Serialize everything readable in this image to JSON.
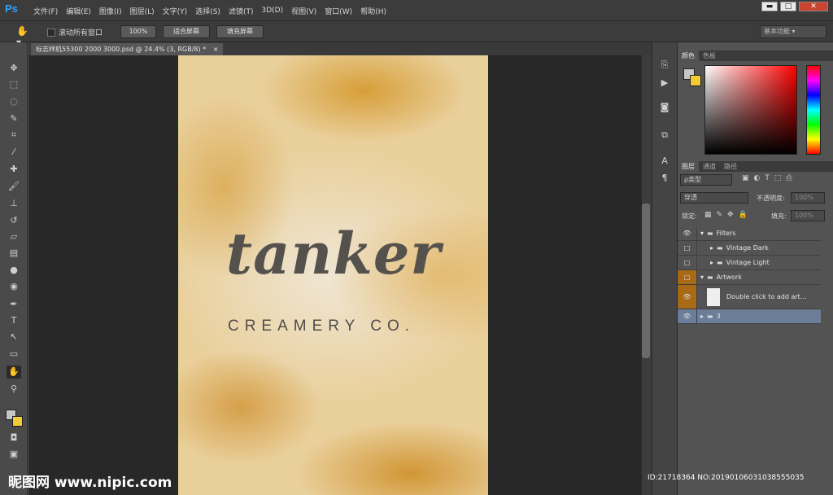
{
  "app": {
    "logo": "Ps"
  },
  "menu": [
    "文件(F)",
    "编辑(E)",
    "图像(I)",
    "图层(L)",
    "文字(Y)",
    "选择(S)",
    "滤镜(T)",
    "3D(D)",
    "视图(V)",
    "窗口(W)",
    "帮助(H)"
  ],
  "window_controls": {
    "minimize": "▬",
    "maximize": "□",
    "close": "✕"
  },
  "options": {
    "hand_icon": "hand-icon",
    "scroll_all_label": "滚动所有窗口",
    "btn_100": "100%",
    "btn_fit": "适合屏幕",
    "btn_fill": "填充屏幕",
    "workspace": "基本功能"
  },
  "document": {
    "tab_title": "标志样机55300 2000 3000.psd @ 24.4% (3, RGB/8) *",
    "tab_close": "×",
    "brand_name": "tanker",
    "brand_sub": "CREAMERY CO."
  },
  "color_panel": {
    "tabs": [
      "颜色",
      "色板"
    ],
    "foreground": "#c6c6c6",
    "background": "#f4ca3a"
  },
  "layers_panel": {
    "tabs": [
      "图层",
      "通道",
      "路径"
    ],
    "filter_label": "ρ类型",
    "blend_mode": "穿透",
    "opacity_label": "不透明度:",
    "opacity_value": "100%",
    "lock_label": "锁定:",
    "fill_label": "填充:",
    "fill_value": "100%",
    "layers": [
      {
        "name": "Filters",
        "visible": true,
        "indent": 0,
        "expanded": true
      },
      {
        "name": "Vintage Dark",
        "visible": false,
        "indent": 1,
        "expanded": false
      },
      {
        "name": "Vintage Light",
        "visible": false,
        "indent": 1,
        "expanded": false
      },
      {
        "name": "Artwork",
        "visible": false,
        "indent": 0,
        "expanded": true
      },
      {
        "name": "Double click to add art...",
        "visible": true,
        "indent": 1,
        "expanded": false
      },
      {
        "name": "3",
        "visible": true,
        "indent": 0,
        "expanded": false,
        "selected": true
      }
    ]
  },
  "watermark": {
    "site": "昵图网 www.nipic.com",
    "id": "ID:21718364 NO:20190106031038555035"
  }
}
